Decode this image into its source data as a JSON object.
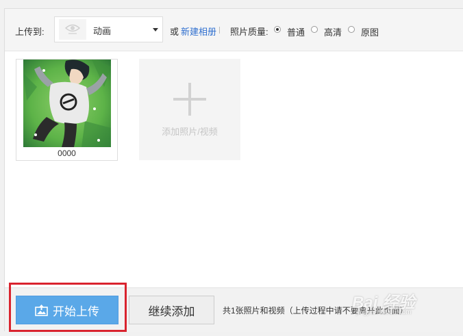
{
  "toolbar": {
    "upload_to_label": "上传到:",
    "album_selected": "动画",
    "or_label": "或",
    "new_album_link": "新建相册",
    "quality_label": "照片质量:",
    "quality_options": [
      {
        "label": "普通",
        "checked": true
      },
      {
        "label": "高清",
        "checked": false
      },
      {
        "label": "原图",
        "checked": false
      }
    ]
  },
  "photos": [
    {
      "name": "0000"
    }
  ],
  "add_tile": {
    "label": "添加照片/视频"
  },
  "footer": {
    "start_upload_label": "开始上传",
    "continue_add_label": "继续添加",
    "count_text": "共1张照片和视频（上传过程中请不要离开此页面）"
  },
  "watermark": {
    "logo": "Bai 经验",
    "url": "jingyan.baidu.com"
  },
  "colors": {
    "accent_blue": "#5aa8e8",
    "link_blue": "#2f6fcf",
    "highlight_red": "#d9232e"
  }
}
